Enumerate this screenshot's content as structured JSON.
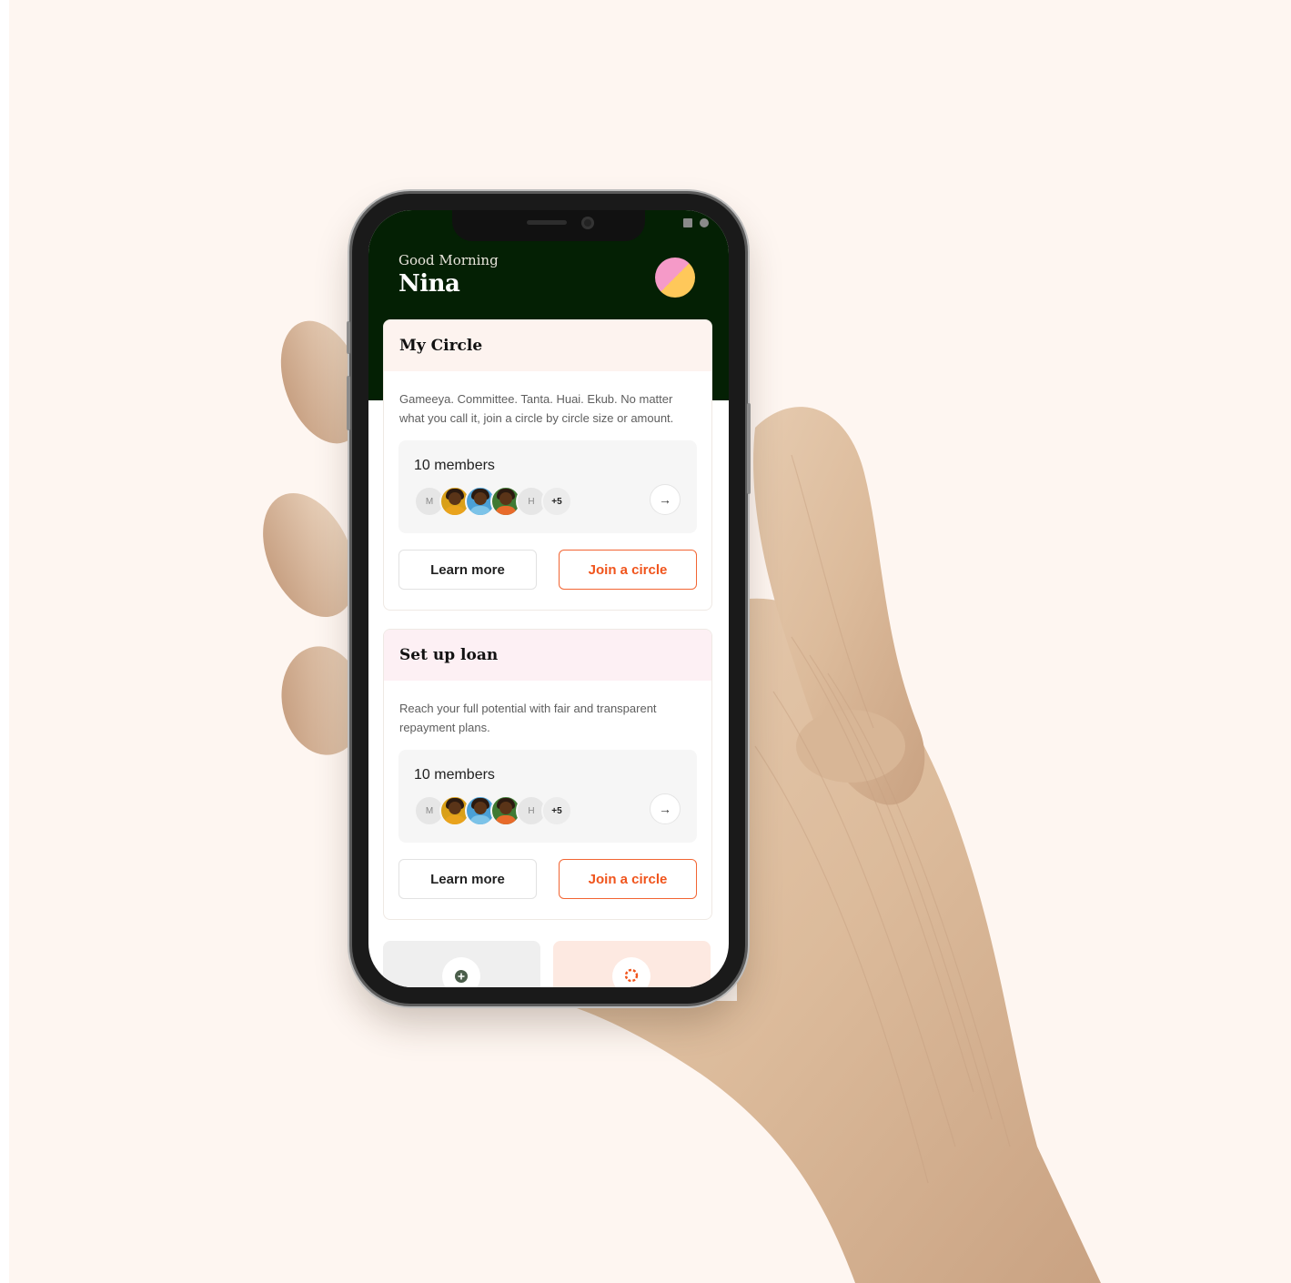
{
  "header": {
    "greeting": "Good Morning",
    "name": "Nina"
  },
  "status_bar": {
    "icons": [
      "square-icon",
      "dot-icon"
    ]
  },
  "cards": [
    {
      "title": "My Circle",
      "description": "Gameeya. Committee. Tanta. Huai. Ekub. No matter what you call it, join a circle by circle size or amount.",
      "members_label": "10 members",
      "avatars": [
        "M",
        "",
        "",
        "",
        "H",
        "+5"
      ],
      "learn_more": "Learn more",
      "join": "Join a circle"
    },
    {
      "title": "Set up loan",
      "description": "Reach your full potential with fair and transparent repayment plans.",
      "members_label": "10 members",
      "avatars": [
        "M",
        "",
        "",
        "",
        "H",
        "+5"
      ],
      "learn_more": "Learn more",
      "join": "Join a circle"
    }
  ],
  "colors": {
    "background": "#fef6f1",
    "header_dark": "#042004",
    "accent": "#f0541c",
    "card1_head": "#fdf3ef",
    "card2_head": "#fdf0f4"
  }
}
